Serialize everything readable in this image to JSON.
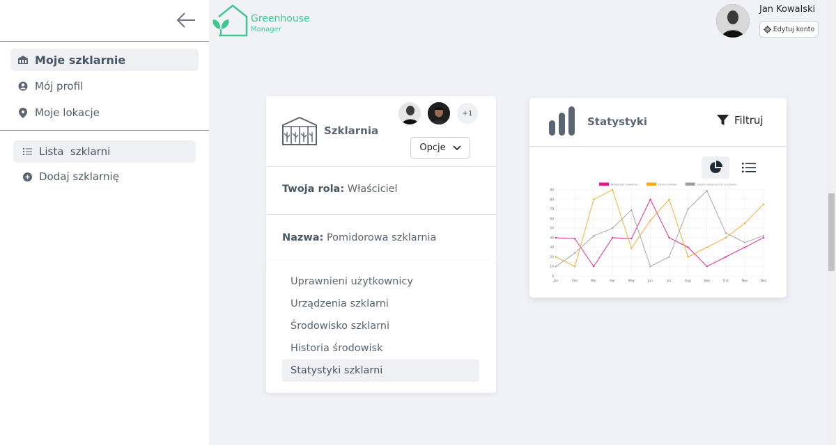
{
  "header": {
    "logo_title": "Greenhouse",
    "logo_subtitle": "Manager",
    "user_name": "Jan Kowalski",
    "edit_account_label": "Edytuj konto"
  },
  "sidebar": {
    "items": [
      {
        "label": "Moje szklarnie",
        "icon": "greenhouse-icon"
      },
      {
        "label": "Mój profil",
        "icon": "user-circle-icon"
      },
      {
        "label": "Moje lokacje",
        "icon": "map-pin-icon"
      }
    ],
    "sub_items": [
      {
        "label": "Lista  szklarni",
        "icon": "list-icon"
      },
      {
        "label": "Dodaj szklarnię",
        "icon": "plus-circle-icon"
      }
    ]
  },
  "greenhouse_card": {
    "title": "Szklarnia",
    "more_members": "+1",
    "options_label": "Opcje",
    "role_key": "Twoja rola:",
    "role_value": "Właściciel",
    "name_key": "Nazwa:",
    "name_value": "Pomidorowa szklarnia"
  },
  "menu": {
    "items": [
      "Uprawnieni użytkownicy",
      "Urządzenia szklarni",
      "Środowisko szklarni",
      "Historia środowisk",
      "Statystyki szklarni"
    ]
  },
  "stats_card": {
    "title": "Statystyki",
    "filter_label": "Filtruj"
  },
  "colors": {
    "accent_green": "#40c78e",
    "series_pink": "#e8168a",
    "series_orange": "#f5a623",
    "series_gray": "#9e9e9e"
  },
  "chart_data": {
    "type": "line",
    "categories": [
      "Jan",
      "Feb",
      "Mar",
      "Apr",
      "May",
      "Jun",
      "Jul",
      "Aug",
      "Sep",
      "Oct",
      "Nov",
      "Dec"
    ],
    "series": [
      {
        "name": "Wilgotność powietrza",
        "color": "#e8168a",
        "values": [
          40,
          39,
          10,
          40,
          39,
          80,
          40,
          30,
          10,
          20,
          30,
          40
        ]
      },
      {
        "name": "Poziom światła",
        "color": "#f5a623",
        "values": [
          20,
          10,
          80,
          90,
          29,
          58,
          80,
          20,
          30,
          40,
          55,
          75
        ]
      },
      {
        "name": "Poziom stężenia CO2 w szklarni",
        "color": "#9e9e9e",
        "values": [
          10,
          24,
          42,
          50,
          69,
          10,
          20,
          70,
          89,
          45,
          35,
          42
        ]
      }
    ],
    "ylim": [
      0,
      90
    ],
    "yticks": [
      0,
      10,
      20,
      30,
      40,
      50,
      60,
      70,
      80,
      90
    ],
    "grid": true,
    "legend_placement": "top"
  }
}
